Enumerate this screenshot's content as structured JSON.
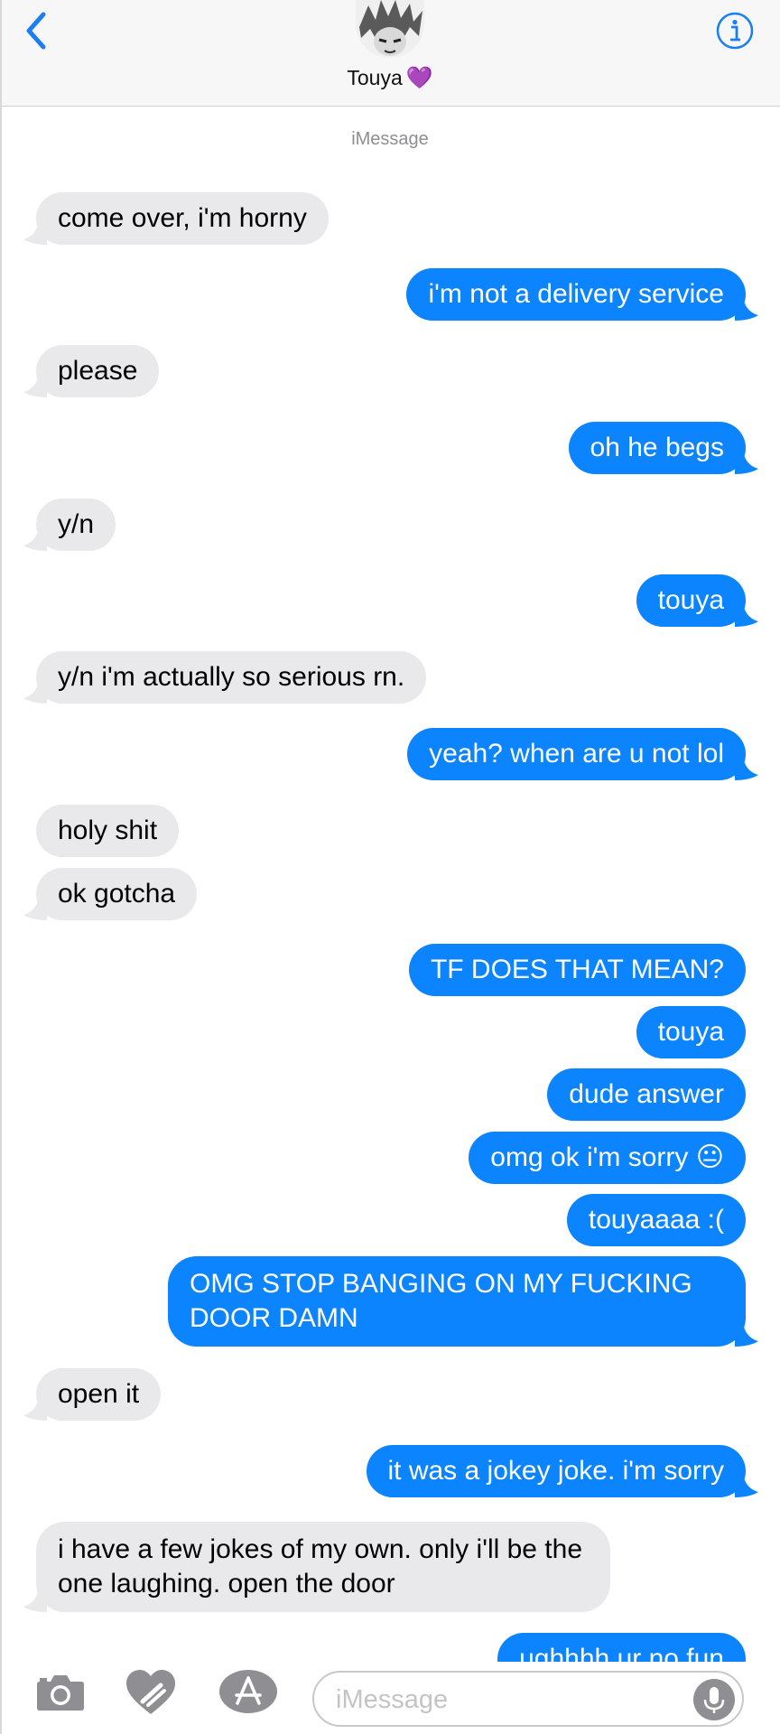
{
  "header": {
    "contact_name": "Touya",
    "name_emoji": "💜"
  },
  "thread": {
    "service_label": "iMessage",
    "messages": [
      {
        "from": "them",
        "text": "come over, i'm horny"
      },
      {
        "from": "me",
        "text": "i'm not a delivery service"
      },
      {
        "from": "them",
        "text": "please"
      },
      {
        "from": "me",
        "text": "oh he begs"
      },
      {
        "from": "them",
        "text": "y/n"
      },
      {
        "from": "me",
        "text": "touya"
      },
      {
        "from": "them",
        "text": "y/n i'm actually so serious rn."
      },
      {
        "from": "me",
        "text": "yeah? when are u not lol"
      },
      {
        "from": "them",
        "text": "holy shit"
      },
      {
        "from": "them",
        "text": "ok gotcha"
      },
      {
        "from": "me",
        "text": "TF DOES THAT MEAN?"
      },
      {
        "from": "me",
        "text": "touya"
      },
      {
        "from": "me",
        "text": "dude answer"
      },
      {
        "from": "me",
        "text": "omg ok i'm sorry 😐"
      },
      {
        "from": "me",
        "text": "touyaaaa :("
      },
      {
        "from": "me",
        "text": "OMG STOP BANGING ON MY FUCKING DOOR DAMN"
      },
      {
        "from": "them",
        "text": "open it"
      },
      {
        "from": "me",
        "text": "it was a jokey joke. i'm sorry"
      },
      {
        "from": "them",
        "text": "i have a few jokes of my own. only i'll be the one laughing. open the door"
      },
      {
        "from": "me",
        "text": "ughhhh ur no fun"
      }
    ]
  },
  "composer": {
    "placeholder": "iMessage",
    "icons": [
      "camera-icon",
      "digital-touch-icon",
      "app-store-icon",
      "microphone-icon"
    ]
  },
  "colors": {
    "outgoing": "#0b84fe",
    "incoming": "#e9e9eb",
    "accent": "#1a7ff5"
  }
}
